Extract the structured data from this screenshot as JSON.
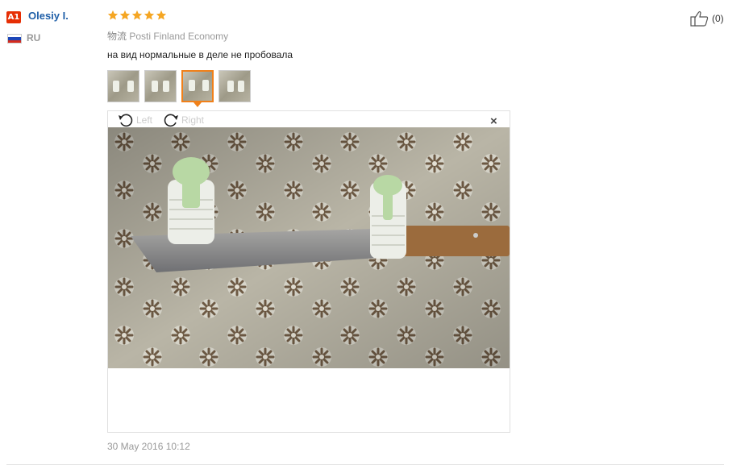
{
  "reviewer": {
    "badge": "A1",
    "name": "Olesiy I.",
    "country": "RU",
    "flag_colors": [
      "#ffffff",
      "#1d46b8",
      "#d52b1e"
    ]
  },
  "rating": {
    "stars": 5,
    "max": 5,
    "star_color": "#f5a623"
  },
  "logistics": {
    "label": "物流",
    "value": "Posti Finland Economy"
  },
  "review_text": "на вид нормальные в деле не пробовала",
  "thumbnails": [
    {
      "name": "photo-1",
      "active": false
    },
    {
      "name": "photo-2",
      "active": false
    },
    {
      "name": "photo-3",
      "active": true
    },
    {
      "name": "photo-4",
      "active": false
    }
  ],
  "viewer": {
    "rotate_left_label": "Left",
    "rotate_right_label": "Right",
    "close_symbol": "×",
    "photo_description_icon": "image"
  },
  "date": "30 May 2016 10:12",
  "helpful": {
    "icon": "thumbs-up-icon",
    "count_label": "(0)"
  },
  "accent_color": "#f0801a"
}
